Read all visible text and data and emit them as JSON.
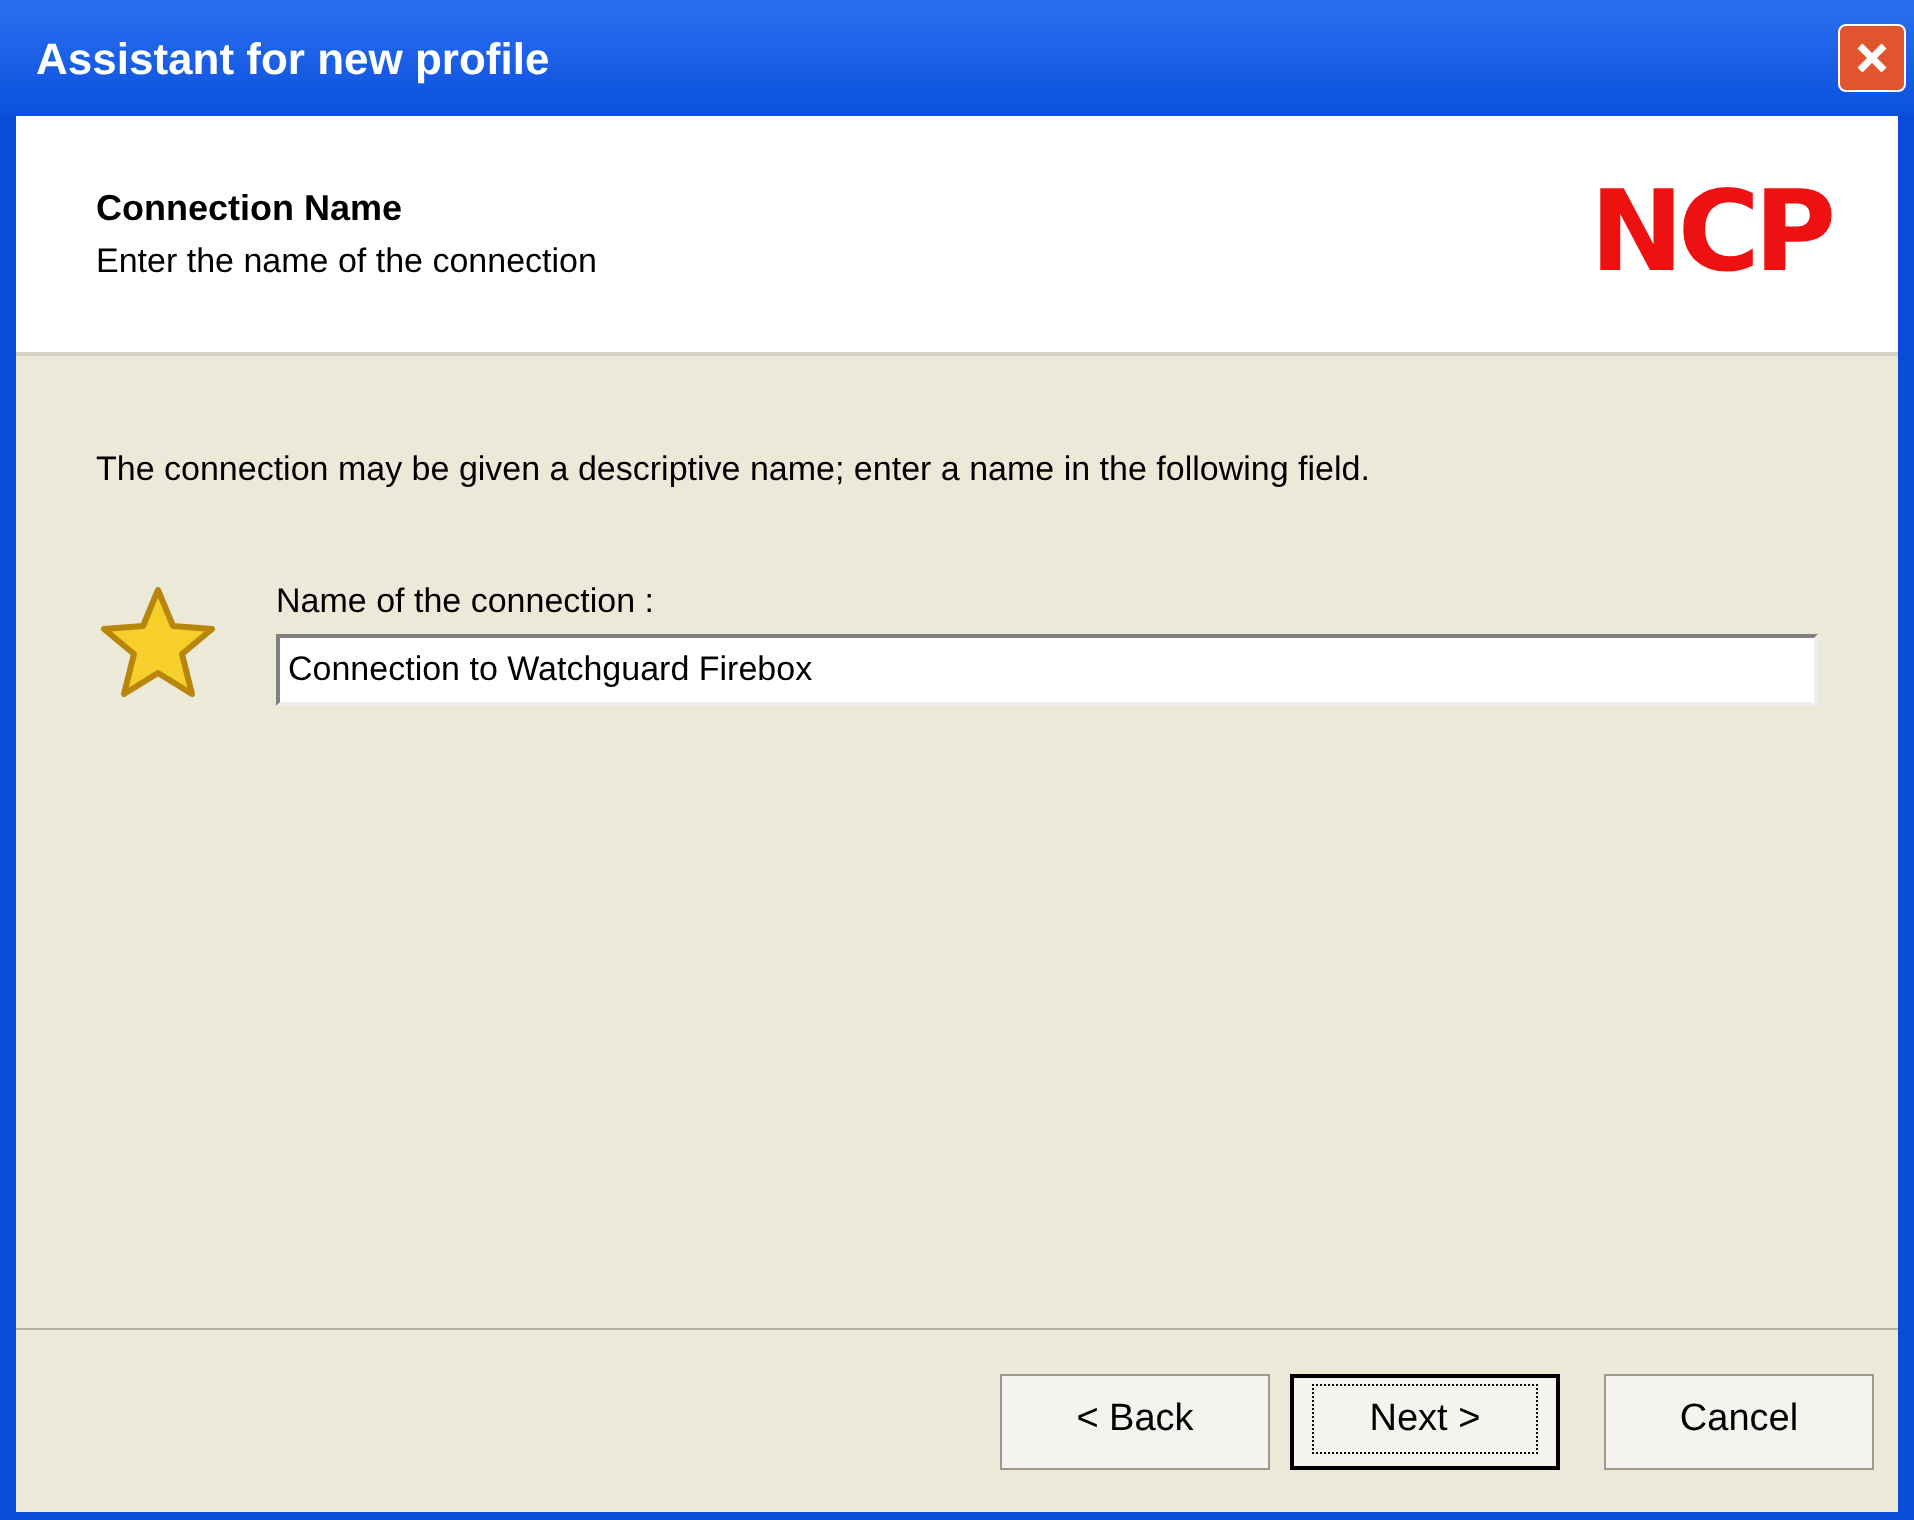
{
  "window": {
    "title": "Assistant for new profile"
  },
  "header": {
    "title": "Connection Name",
    "subtitle": "Enter the name of the connection",
    "logo": "NCP"
  },
  "description": "The connection may be given a descriptive name; enter a name in the following field.",
  "field": {
    "label": "Name of the connection :",
    "value": "Connection to Watchguard Firebox"
  },
  "buttons": [
    {
      "label": "< Back",
      "default": false
    },
    {
      "label": "Next >",
      "default": true
    },
    {
      "label": "Cancel",
      "default": false
    }
  ]
}
